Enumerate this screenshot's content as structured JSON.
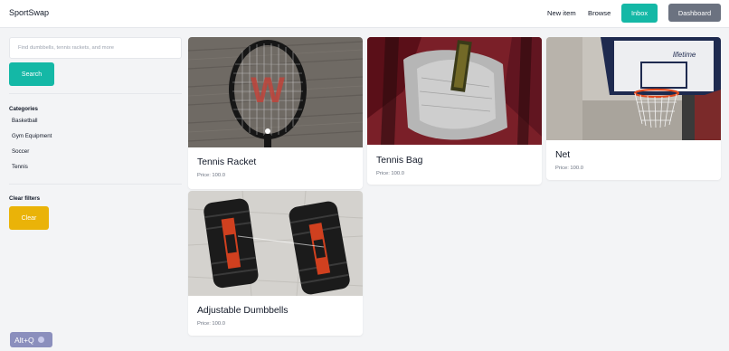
{
  "header": {
    "brand": "SportSwap",
    "nav": {
      "new_item": "New item",
      "browse": "Browse"
    },
    "inbox_label": "Inbox",
    "dashboard_label": "Dashboard"
  },
  "sidebar": {
    "search": {
      "placeholder": "Find dumbbells, tennis rackets, and more",
      "value": ""
    },
    "search_button": "Search",
    "categories_title": "Categories",
    "categories": [
      "Basketball",
      "Gym Equipment",
      "Soccer",
      "Tennis"
    ],
    "clear_title": "Clear filters",
    "clear_button": "Clear"
  },
  "items": [
    {
      "title": "Tennis Racket",
      "price": "Price: 100.0",
      "image_icon": "tennis-racket-photo"
    },
    {
      "title": "Tennis Bag",
      "price": "Price: 100.0",
      "image_icon": "tennis-bag-photo"
    },
    {
      "title": "Net",
      "price": "Price: 100.0",
      "image_icon": "basketball-hoop-photo"
    },
    {
      "title": "Adjustable Dumbbells",
      "price": "Price: 100.0",
      "image_icon": "dumbbells-photo"
    }
  ],
  "overlay": {
    "shortcut_label": "Alt+Q"
  },
  "colors": {
    "teal": "#14b8a6",
    "gray_button": "#6b7280",
    "yellow": "#eab308",
    "page_bg": "#f3f4f6"
  }
}
